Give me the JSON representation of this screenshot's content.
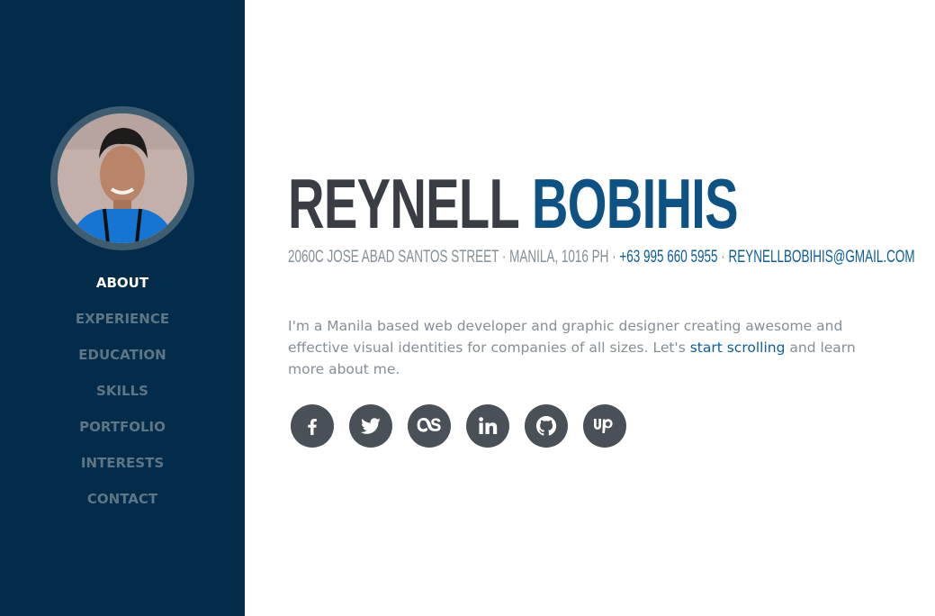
{
  "sidebar": {
    "avatar_alt": "Reynell Bobihis profile photo",
    "nav": [
      {
        "label": "ABOUT",
        "active": true
      },
      {
        "label": "EXPERIENCE",
        "active": false
      },
      {
        "label": "EDUCATION",
        "active": false
      },
      {
        "label": "SKILLS",
        "active": false
      },
      {
        "label": "PORTFOLIO",
        "active": false
      },
      {
        "label": "INTERESTS",
        "active": false
      },
      {
        "label": "CONTACT",
        "active": false
      }
    ]
  },
  "hero": {
    "first_name": "REYNELL",
    "last_name": "BOBIHIS",
    "address": "2060C Jose Abad Santos Street · Manila, 1016 PH ·",
    "phone": "+63 995 660 5955",
    "separator": " · ",
    "email": "REYNELLBOBIHIS@GMAIL.COM",
    "intro_before": "I'm a Manila based web developer and graphic designer creating awesome and effective visual identities for companies of all sizes. Let's",
    "intro_link": "start scrolling",
    "intro_after": "and learn more about me."
  },
  "social": [
    {
      "name": "facebook-icon"
    },
    {
      "name": "twitter-icon"
    },
    {
      "name": "lastfm-icon"
    },
    {
      "name": "linkedin-icon"
    },
    {
      "name": "github-icon"
    },
    {
      "name": "upwork-icon"
    }
  ],
  "colors": {
    "sidebar_bg": "#022c49",
    "accent": "#0d5283",
    "link": "#0d5e97",
    "text_muted": "#868e96",
    "social_bg": "#495057"
  }
}
